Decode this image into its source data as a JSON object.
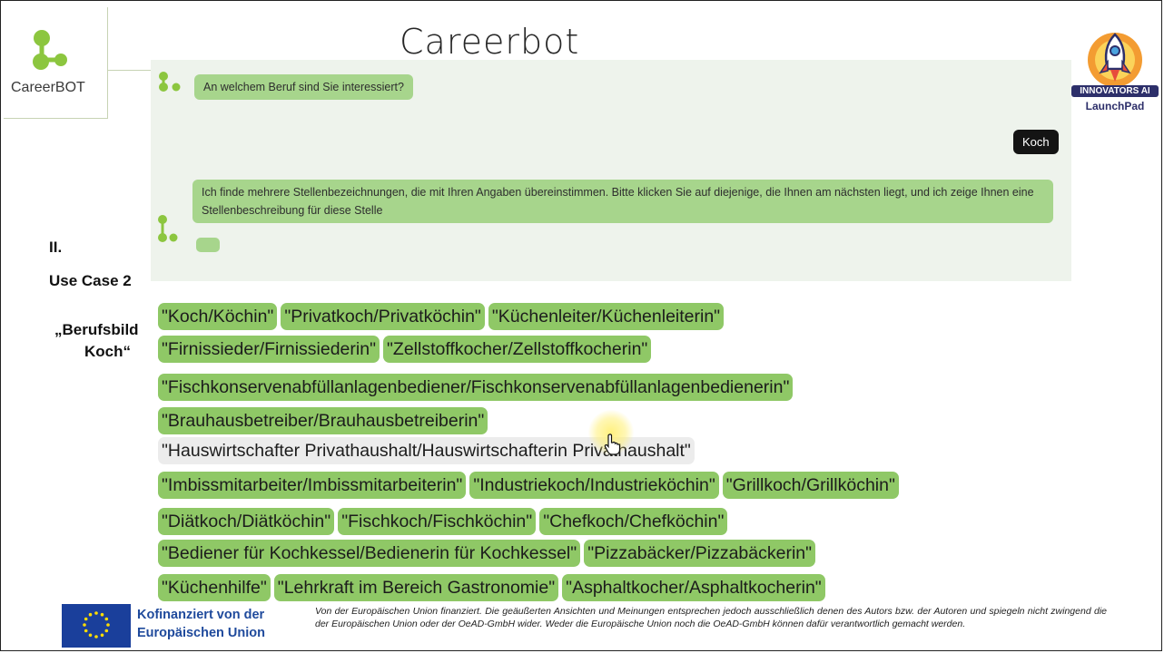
{
  "title": "Careerbot",
  "logo": {
    "text": "CareerBOT",
    "color": "#8cc63f"
  },
  "badge": {
    "line1": "INNOVATORS AI",
    "line2": "LaunchPad"
  },
  "side": {
    "section": "II.",
    "use_case": "Use Case 2",
    "topic_line1": "„Berufsbild",
    "topic_line2": "Koch“"
  },
  "chat": {
    "question": "An welchem Beruf sind Sie interessiert?",
    "user_reply": "Koch",
    "answer": "Ich finde mehrere Stellenbezeichnungen, die mit Ihren Angaben übereinstimmen. Bitte klicken Sie auf diejenige, die Ihnen am nächsten liegt, und ich zeige Ihnen eine Stellenbeschreibung für diese Stelle"
  },
  "chips": [
    [
      "\"Koch/Köchin\"",
      "\"Privatkoch/Privatköchin\"",
      "\"Küchenleiter/Küchenleiterin\""
    ],
    [
      "\"Firnissieder/Firnissiederin\"",
      "\"Zellstoffkocher/Zellstoffkocherin\""
    ],
    [
      "\"Fischkonservenabfüllanlagenbediener/Fischkonservenabfüllanlagenbedienerin\""
    ],
    [
      "\"Brauhausbetreiber/Brauhausbetreiberin\""
    ],
    [
      "\"Hauswirtschafter Privathaushalt/Hauswirtschafterin Privathaushalt\""
    ],
    [
      "\"Imbissmitarbeiter/Imbissmitarbeiterin\"",
      "\"Industriekoch/Industrieköchin\"",
      "\"Grillkoch/Grillköchin\""
    ],
    [
      "\"Diätkoch/Diätköchin\"",
      "\"Fischkoch/Fischköchin\"",
      "\"Chefkoch/Chefköchin\""
    ],
    [
      "\"Bediener für Kochkessel/Bedienerin für Kochkessel\"",
      "\"Pizzabäcker/Pizzabäckerin\""
    ],
    [
      "\"Küchenhilfe\"",
      "\"Lehrkraft im Bereich Gastronomie\"",
      "\"Asphaltkocher/Asphaltkocherin\""
    ]
  ],
  "hovered_chip": "\"Hauswirtschafter Privathaushalt/Hauswirtschafterin Privathaushalt\"",
  "footer": {
    "eu_line1": "Kofinanziert von der",
    "eu_line2": "Europäischen Union",
    "disclaimer": "Von der Europäischen Union finanziert. Die geäußerten Ansichten und Meinungen entsprechen jedoch ausschließlich denen des Autors bzw. der Autoren und spiegeln nicht zwingend die der Europäischen Union oder der OeAD-GmbH wider. Weder die Europäische Union noch die OeAD-GmbH können dafür verantwortlich gemacht werden."
  },
  "colors": {
    "chip": "#8fc866",
    "chip_hover": "#ececec",
    "bot_bubble": "#a7d58c",
    "user_bubble": "#141414",
    "chat_bg": "#eef3ec",
    "eu_blue": "#1f4a9c"
  },
  "icons": [
    "careerbot-logo-icon",
    "rocket-badge-icon",
    "bot-avatar-icon",
    "hand-cursor-icon",
    "eu-flag-icon"
  ]
}
